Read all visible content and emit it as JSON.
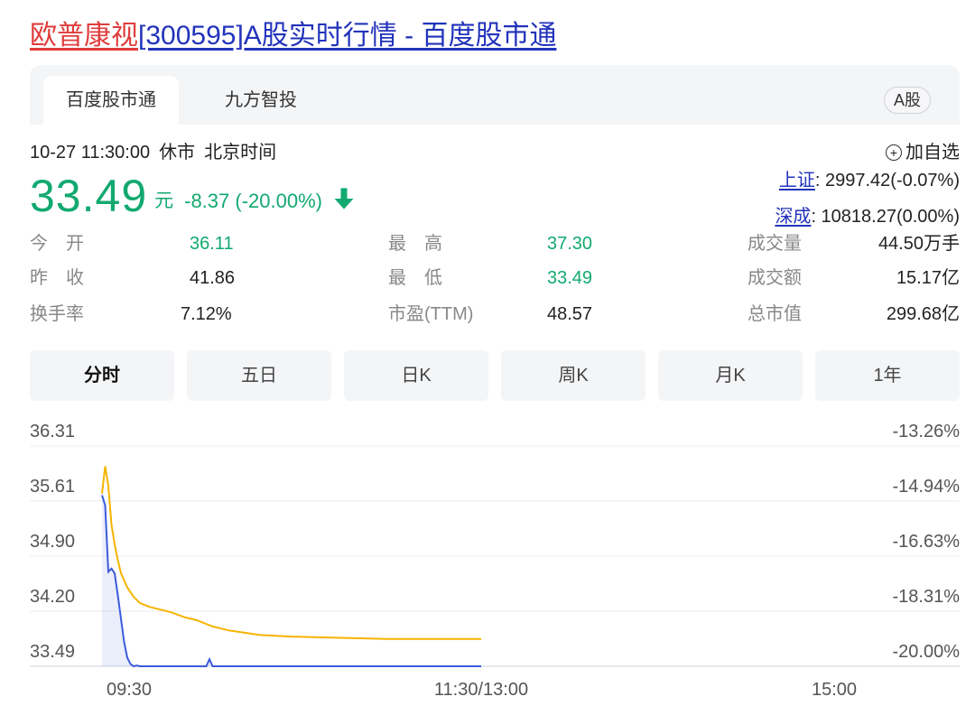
{
  "title": {
    "company": "欧普康视",
    "rest": "[300595]A股实时行情 - 百度股市通"
  },
  "tabs": [
    {
      "label": "百度股市通"
    },
    {
      "label": "九方智投"
    }
  ],
  "market_badge": "A股",
  "status": {
    "datetime": "10-27 11:30:00",
    "state": "休市",
    "tz": "北京时间"
  },
  "add_watchlist": "加自选",
  "quote": {
    "price": "33.49",
    "unit": "元",
    "change": "-8.37 (-20.00%)",
    "color": "#12a971"
  },
  "indices": [
    {
      "name": "上证",
      "value": ": 2997.42(-0.07%)"
    },
    {
      "name": "深成",
      "value": ": 10818.27(0.00%)"
    }
  ],
  "stats": [
    {
      "label": "今　开",
      "value": "36.11"
    },
    {
      "label": "最　高",
      "value": "37.30"
    },
    {
      "label": "成交量",
      "value": "44.50万手"
    },
    {
      "label": "昨　收",
      "value": "41.86"
    },
    {
      "label": "最　低",
      "value": "33.49"
    },
    {
      "label": "成交额",
      "value": "15.17亿"
    },
    {
      "label": "换手率",
      "value": "7.12%"
    },
    {
      "label": "市盈(TTM)",
      "value": "48.57"
    },
    {
      "label": "总市值",
      "value": "299.68亿"
    }
  ],
  "period_tabs": [
    "分时",
    "五日",
    "日K",
    "周K",
    "月K",
    "1年"
  ],
  "chart_data": {
    "type": "line",
    "y_ticks": [
      "36.31",
      "35.61",
      "34.90",
      "34.20",
      "33.49"
    ],
    "pct_ticks": [
      "-13.26%",
      "-14.94%",
      "-16.63%",
      "-18.31%",
      "-20.00%"
    ],
    "x_ticks": [
      "09:30",
      "11:30/13:00",
      "15:00"
    ],
    "ylim": [
      33.49,
      36.31
    ],
    "x_session_minutes": 240,
    "series": [
      {
        "color": "#f5b400",
        "x": [
          0,
          1,
          2,
          3,
          4,
          5,
          6,
          8,
          10,
          12,
          15,
          18,
          22,
          26,
          30,
          35,
          40,
          45,
          50,
          55,
          60,
          70,
          80,
          90,
          100,
          110,
          120
        ],
        "values": [
          35.7,
          36.05,
          35.8,
          35.3,
          35.05,
          34.85,
          34.68,
          34.5,
          34.38,
          34.3,
          34.25,
          34.22,
          34.18,
          34.12,
          34.08,
          34.0,
          33.95,
          33.92,
          33.89,
          33.88,
          33.87,
          33.86,
          33.85,
          33.84,
          33.84,
          33.84,
          33.84
        ]
      },
      {
        "color": "#3b5bdb",
        "x": [
          0,
          1,
          2,
          3,
          4,
          5,
          6,
          7,
          8,
          9,
          10,
          11,
          12,
          15,
          20,
          25,
          30,
          33,
          34,
          35,
          40,
          60,
          80,
          100,
          120
        ],
        "values": [
          35.68,
          35.55,
          34.7,
          34.74,
          34.68,
          34.4,
          34.1,
          33.8,
          33.6,
          33.52,
          33.49,
          33.5,
          33.49,
          33.49,
          33.49,
          33.49,
          33.49,
          33.49,
          33.58,
          33.49,
          33.49,
          33.49,
          33.49,
          33.49,
          33.49
        ]
      }
    ]
  }
}
